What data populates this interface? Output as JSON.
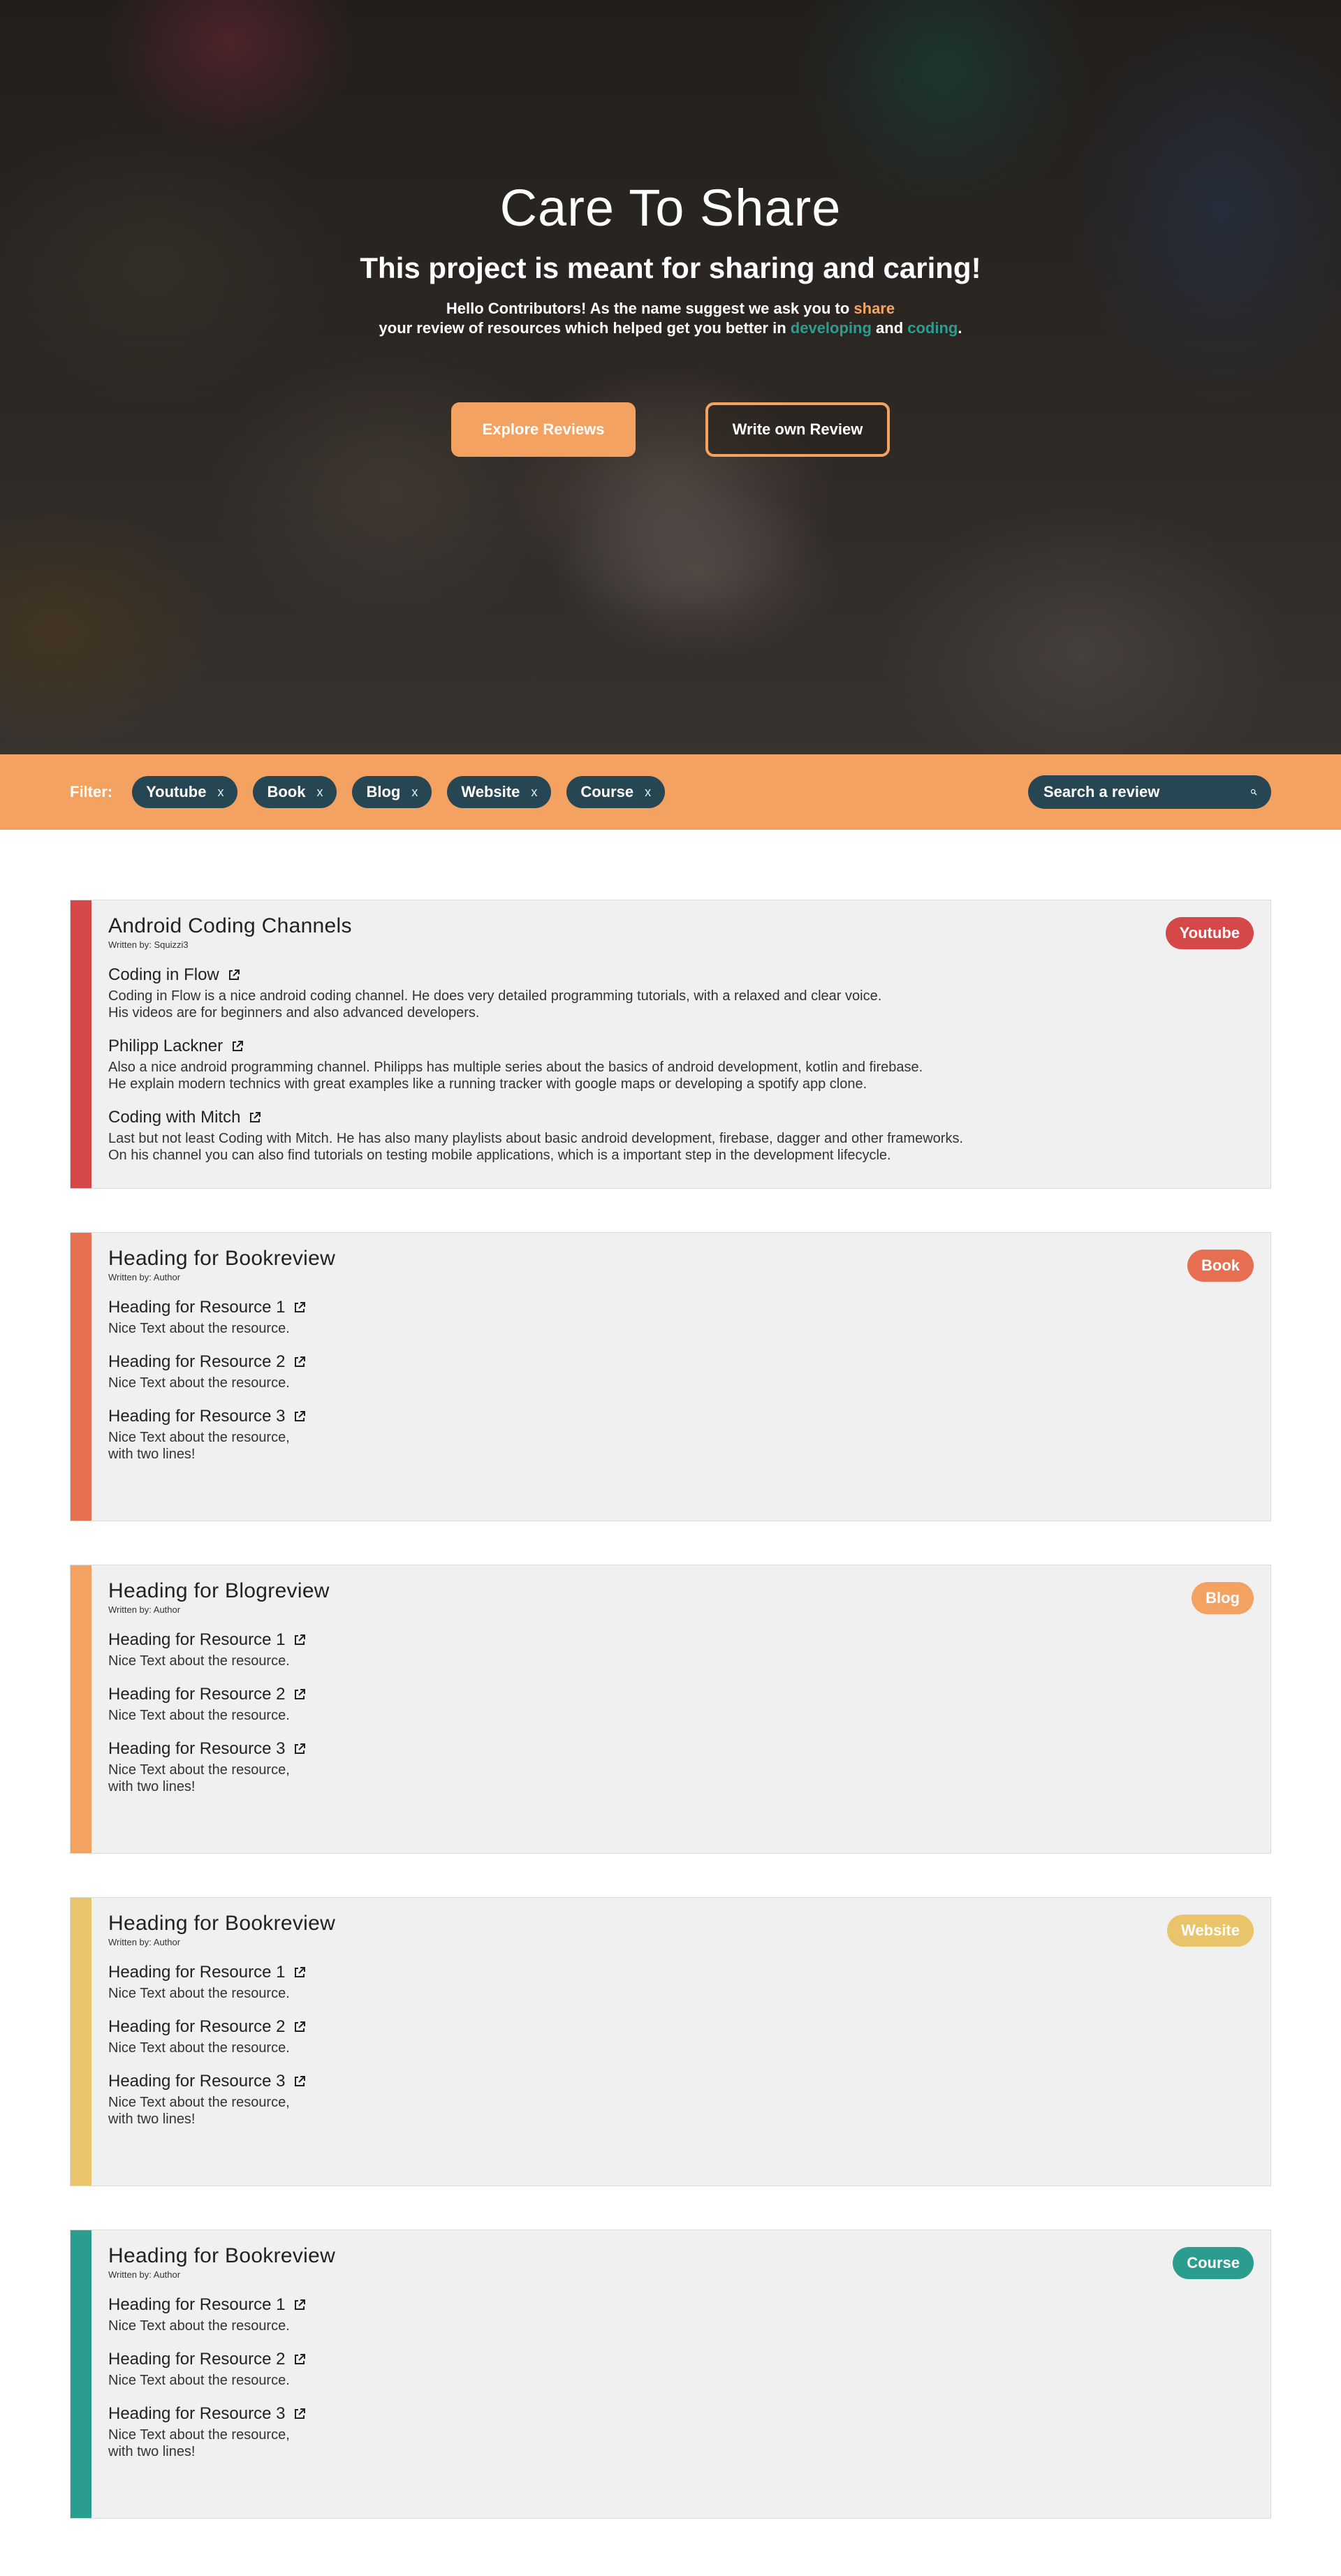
{
  "hero": {
    "title": "Care To Share",
    "subtitle": "This project is meant for sharing and caring!",
    "intro_part1": "Hello Contributors! As the name suggest we ask you to ",
    "intro_share": "share",
    "intro_part2": "your review of resources which helped get you better in ",
    "intro_developing": "developing",
    "intro_and": " and ",
    "intro_coding": "coding",
    "intro_end": ".",
    "explore_button": "Explore Reviews",
    "write_button": "Write own Review"
  },
  "filter": {
    "label": "Filter:",
    "chips": [
      {
        "label": "Youtube",
        "remove": "x"
      },
      {
        "label": "Book",
        "remove": "x"
      },
      {
        "label": "Blog",
        "remove": "x"
      },
      {
        "label": "Website",
        "remove": "x"
      },
      {
        "label": "Course",
        "remove": "x"
      }
    ],
    "search_placeholder": "Search a review",
    "search_icon": "search-icon"
  },
  "colors": {
    "accent_orange": "#f4a261",
    "dark_teal": "#264653",
    "youtube": "#d44848",
    "book": "#e76f51",
    "blog": "#f4a261",
    "website": "#e9c46a",
    "course": "#2a9d8f"
  },
  "reviews": [
    {
      "title": "Android Coding Channels",
      "author": "Written by: Squizzi3",
      "badge": "Youtube",
      "resources": [
        {
          "heading": "Coding in Flow",
          "text": "Coding in Flow is a nice android coding channel. He does very detailed programming tutorials, with a relaxed and clear voice.\nHis videos are for beginners and also advanced developers."
        },
        {
          "heading": "Philipp Lackner",
          "text": "Also a nice android programming channel. Philipps has multiple series about the basics of android development, kotlin and firebase.\nHe explain modern technics with great examples like a running tracker with google maps or developing a spotify app clone."
        },
        {
          "heading": "Coding with Mitch",
          "text": "Last but not least Coding with Mitch. He has also many playlists about basic android development, firebase, dagger and other frameworks.\nOn his channel you can also find tutorials on testing mobile applications, which is a important step in the development lifecycle."
        }
      ]
    },
    {
      "title": "Heading for Bookreview",
      "author": "Written by: Author",
      "badge": "Book",
      "resources": [
        {
          "heading": "Heading for Resource 1",
          "text": "Nice Text about the resource."
        },
        {
          "heading": "Heading for Resource 2",
          "text": "Nice Text about the resource."
        },
        {
          "heading": "Heading for Resource 3",
          "text": "Nice Text about the resource,\nwith two lines!"
        }
      ]
    },
    {
      "title": "Heading for Blogreview",
      "author": "Written by: Author",
      "badge": "Blog",
      "resources": [
        {
          "heading": "Heading for Resource 1",
          "text": "Nice Text about the resource."
        },
        {
          "heading": "Heading for Resource 2",
          "text": "Nice Text about the resource."
        },
        {
          "heading": "Heading for Resource 3",
          "text": "Nice Text about the resource,\nwith two lines!"
        }
      ]
    },
    {
      "title": "Heading for Bookreview",
      "author": "Written by: Author",
      "badge": "Website",
      "resources": [
        {
          "heading": "Heading for Resource 1",
          "text": "Nice Text about the resource."
        },
        {
          "heading": "Heading for Resource 2",
          "text": "Nice Text about the resource."
        },
        {
          "heading": "Heading for Resource 3",
          "text": "Nice Text about the resource,\nwith two lines!"
        }
      ]
    },
    {
      "title": "Heading for Bookreview",
      "author": "Written by: Author",
      "badge": "Course",
      "resources": [
        {
          "heading": "Heading for Resource 1",
          "text": "Nice Text about the resource."
        },
        {
          "heading": "Heading for Resource 2",
          "text": "Nice Text about the resource."
        },
        {
          "heading": "Heading for Resource 3",
          "text": "Nice Text about the resource,\nwith two lines!"
        }
      ]
    }
  ]
}
